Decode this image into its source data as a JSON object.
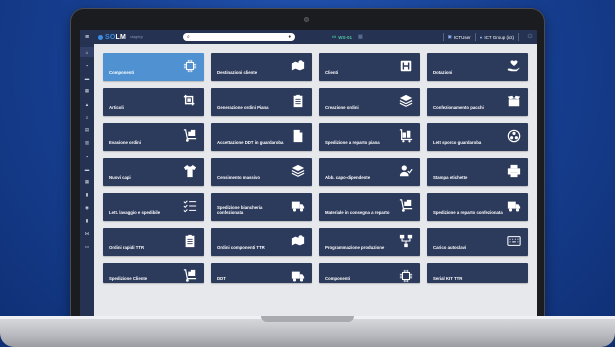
{
  "topbar": {
    "menu_icon": "hamburger-icon",
    "logo_prefix": "SO",
    "logo_suffix": "LM",
    "logo_sub": "staging",
    "search_placeholder": "",
    "workstation": "WS-01",
    "user_label": "ICTUser",
    "group_label": "ICT Group (ict)"
  },
  "sidebar": {
    "items": [
      {
        "icon": "home-icon",
        "glyph": "⌂"
      },
      {
        "icon": "box-icon",
        "glyph": "▪"
      },
      {
        "icon": "chart-icon",
        "glyph": "▬"
      },
      {
        "icon": "grid-icon",
        "glyph": "▦"
      },
      {
        "icon": "user-icon",
        "glyph": "▲"
      },
      {
        "icon": "list-icon",
        "glyph": "≡"
      },
      {
        "icon": "list-icon",
        "glyph": "▤"
      },
      {
        "icon": "list-icon",
        "glyph": "▥"
      },
      {
        "icon": "cart-icon",
        "glyph": "▪"
      },
      {
        "icon": "chart-icon",
        "glyph": "▬"
      },
      {
        "icon": "settings-icon",
        "glyph": "▦"
      },
      {
        "icon": "file-icon",
        "glyph": "▮"
      },
      {
        "icon": "clock-icon",
        "glyph": "◉"
      },
      {
        "icon": "file-icon",
        "glyph": "▮"
      },
      {
        "icon": "flow-icon",
        "glyph": "⋈"
      },
      {
        "icon": "keyboard-icon",
        "glyph": "▭"
      }
    ]
  },
  "tiles": [
    {
      "label": "Componenti",
      "icon": "chip-icon",
      "active": true
    },
    {
      "label": "Destinazioni cliente",
      "icon": "map-icon"
    },
    {
      "label": "Clienti",
      "icon": "hospital-icon"
    },
    {
      "label": "Dotazioni",
      "icon": "hand-heart-icon"
    },
    {
      "label": "Articoli",
      "icon": "crop-icon"
    },
    {
      "label": "Generazione ordini Piana",
      "icon": "clipboard-icon"
    },
    {
      "label": "Creazione ordini",
      "icon": "layers-icon"
    },
    {
      "label": "Confezionamento pacchi",
      "icon": "box-open-icon"
    },
    {
      "label": "Evasione ordini",
      "icon": "dolly-icon"
    },
    {
      "label": "Accettazione DDT in guardaroba",
      "icon": "document-icon"
    },
    {
      "label": "Spedizione a reparto piana",
      "icon": "luggage-cart-icon"
    },
    {
      "label": "Lett sporco guardaroba",
      "icon": "biohazard-icon"
    },
    {
      "label": "Nuovi capi",
      "icon": "tshirt-icon"
    },
    {
      "label": "Censimento massivo",
      "icon": "layers-icon"
    },
    {
      "label": "Abb. capo-dipendente",
      "icon": "user-check-icon"
    },
    {
      "label": "Stampa etichette",
      "icon": "printer-icon"
    },
    {
      "label": "Lett. lavaggio e spedibile",
      "icon": "checklist-icon"
    },
    {
      "label": "Spedizione biancheria confezionata",
      "icon": "truck-icon"
    },
    {
      "label": "Materiale in consegna a reparto",
      "icon": "dolly-icon"
    },
    {
      "label": "Spedizione a reparto confezionata",
      "icon": "truck-icon"
    },
    {
      "label": "Ordini rapidi TTR",
      "icon": "clipboard-icon"
    },
    {
      "label": "Ordini componenti TTR",
      "icon": "map-icon"
    },
    {
      "label": "Programmazione produzione",
      "icon": "flow-icon"
    },
    {
      "label": "Carico autoclavi",
      "icon": "keyboard-icon"
    },
    {
      "label": "Spedizione Cliente",
      "icon": "dolly-icon"
    },
    {
      "label": "DDT",
      "icon": "truck-icon"
    },
    {
      "label": "Componenti",
      "icon": "chip-icon"
    },
    {
      "label": "Serial KIT TTR",
      "icon": ""
    }
  ],
  "colors": {
    "background": "#163e8f",
    "topbar": "#263252",
    "tile": "#2c3a5c",
    "tile_active": "#5091d1",
    "screen_bg": "#e6e8ec"
  }
}
